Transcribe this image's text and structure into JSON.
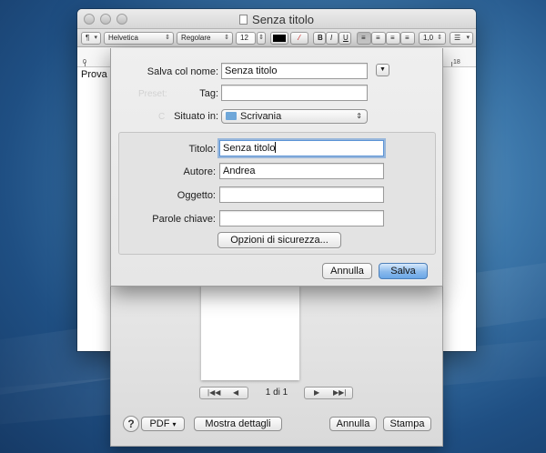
{
  "window": {
    "title": "Senza titolo",
    "font_family_popup": "Helvetica",
    "font_style_popup": "Regolare",
    "font_size": "12",
    "bold": "B",
    "italic": "I",
    "underline": "U",
    "line_spacing": "1,0",
    "paragraph_style": "¶",
    "ruler_start": "0",
    "ruler_end": "18",
    "document_text": "Prova"
  },
  "save_dialog": {
    "save_as_label": "Salva col nome:",
    "save_as_value": "Senza titolo",
    "tags_label": "Tag:",
    "tags_value": "",
    "where_label": "Situato in:",
    "where_value": "Scrivania",
    "title_label": "Titolo:",
    "title_value": "Senza titolo",
    "author_label": "Autore:",
    "author_value": "Andrea",
    "subject_label": "Oggetto:",
    "subject_value": "",
    "keywords_label": "Parole chiave:",
    "keywords_value": "",
    "security_button": "Opzioni di sicurezza...",
    "cancel_button": "Annulla",
    "save_button": "Salva"
  },
  "print_dialog": {
    "page_count": "1 di 1",
    "help_button": "?",
    "pdf_button": "PDF",
    "details_button": "Mostra dettagli",
    "cancel_button": "Annulla",
    "print_button": "Stampa"
  },
  "colors": {
    "desktop": "#3d78ab",
    "default_button": "#6aa6e6",
    "focus_ring": "#5b93d6"
  }
}
